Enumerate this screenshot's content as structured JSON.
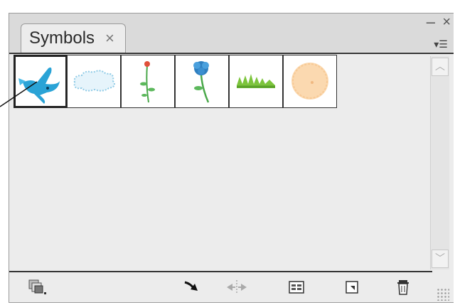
{
  "panel": {
    "tab_label": "Symbols",
    "tab_close_glyph": "×",
    "minimize_glyph": "–",
    "close_glyph": "×",
    "menu_glyph": "▾☰"
  },
  "symbols": [
    {
      "name": "bird",
      "icon": "bird-icon",
      "selected": true
    },
    {
      "name": "cloud",
      "icon": "cloud-icon",
      "selected": false
    },
    {
      "name": "red flower",
      "icon": "red-flower-icon",
      "selected": false
    },
    {
      "name": "blue flower",
      "icon": "blue-flower-icon",
      "selected": false
    },
    {
      "name": "grass",
      "icon": "grass-icon",
      "selected": false
    },
    {
      "name": "dot",
      "icon": "peach-dot-icon",
      "selected": false
    }
  ],
  "scrollbar": {
    "up_glyph": "︿",
    "down_glyph": "﹀"
  },
  "bottom_buttons": [
    {
      "icon": "symbol-libraries-menu-icon"
    },
    {
      "icon": "place-symbol-instance-icon"
    },
    {
      "icon": "break-link-icon"
    },
    {
      "icon": "symbol-options-icon"
    },
    {
      "icon": "new-symbol-icon"
    },
    {
      "icon": "delete-symbol-icon"
    }
  ]
}
